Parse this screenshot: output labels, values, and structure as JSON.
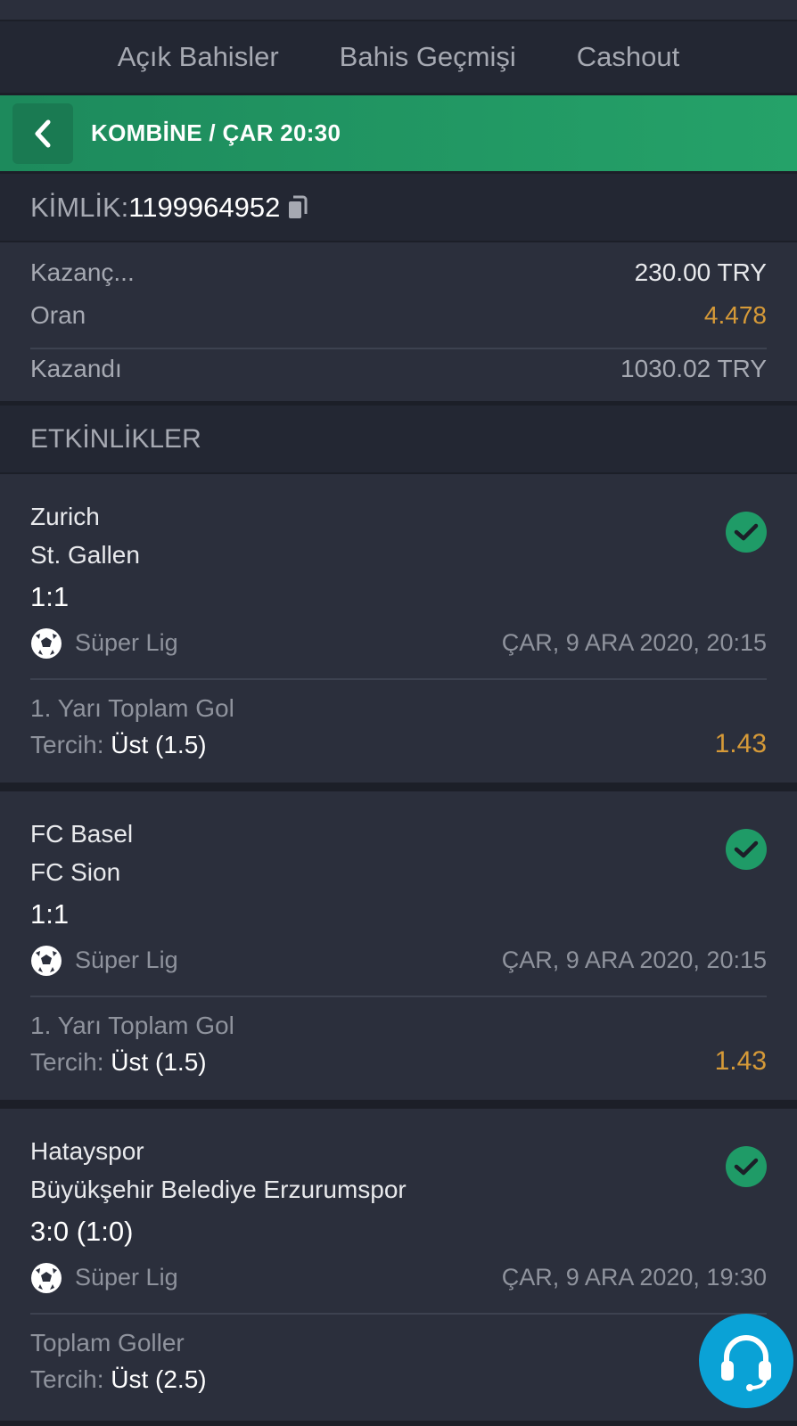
{
  "tabs": [
    "Açık Bahisler",
    "Bahis Geçmişi",
    "Cashout"
  ],
  "header": {
    "title": "KOMBİNE / ÇAR 20:30"
  },
  "ticket": {
    "id_label": "KİMLİK:",
    "id_value": "1199964952"
  },
  "summary": {
    "stake_label": "Kazanç...",
    "stake_value": "230.00 TRY",
    "odds_label": "Oran",
    "odds_value": "4.478",
    "won_label": "Kazandı",
    "won_value": "1030.02 TRY"
  },
  "section_title": "ETKİNLİKLER",
  "events": [
    {
      "home": "Zurich",
      "away": "St. Gallen",
      "score": "1:1",
      "league": "Süper Lig",
      "date": "ÇAR, 9 ARA 2020, 20:15",
      "market": "1. Yarı Toplam Gol",
      "pick_label": "Tercih:",
      "pick_value": "Üst (1.5)",
      "odds": "1.43"
    },
    {
      "home": "FC Basel",
      "away": "FC Sion",
      "score": "1:1",
      "league": "Süper Lig",
      "date": "ÇAR, 9 ARA 2020, 20:15",
      "market": "1. Yarı Toplam Gol",
      "pick_label": "Tercih:",
      "pick_value": "Üst (1.5)",
      "odds": "1.43"
    },
    {
      "home": "Hatayspor",
      "away": "Büyükşehir Belediye Erzurumspor",
      "score": "3:0 (1:0)",
      "league": "Süper Lig",
      "date": "ÇAR, 9 ARA 2020, 19:30",
      "market": "Toplam Goller",
      "pick_label": "Tercih:",
      "pick_value": "Üst (2.5)",
      "odds": ""
    }
  ],
  "colors": {
    "accent_green": "#1f9b67",
    "odds": "#d69a38",
    "support": "#0aa2d6"
  }
}
